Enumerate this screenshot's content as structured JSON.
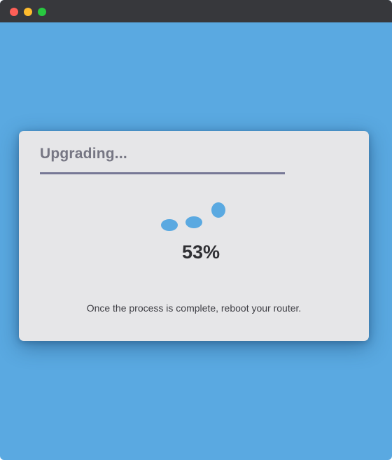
{
  "window": {
    "buttons": [
      {
        "name": "close",
        "color": "#fe5f57"
      },
      {
        "name": "minimize",
        "color": "#febc2e"
      },
      {
        "name": "maximize",
        "color": "#28c840"
      }
    ],
    "background_color": "#5aa9e1"
  },
  "dialog": {
    "title": "Upgrading...",
    "progress": {
      "value": 53,
      "label": "53%"
    },
    "spinner_icon": "loading-dots-icon",
    "message": "Once the process is complete, reboot your router."
  }
}
